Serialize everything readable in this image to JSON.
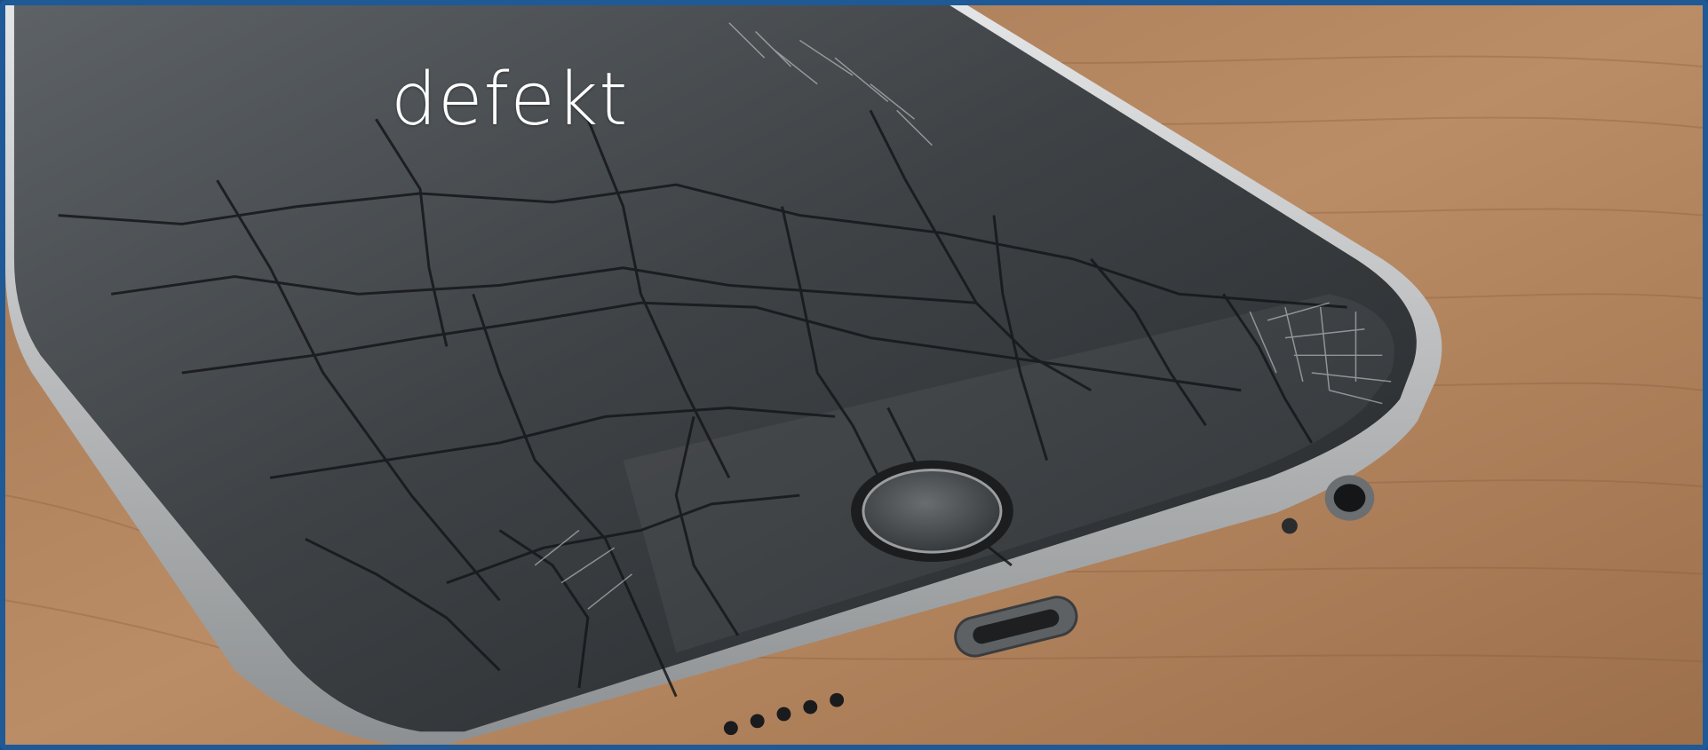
{
  "headline": "defekt",
  "image": {
    "subject": "smartphone-with-cracked-screen",
    "colors": {
      "frame": "#1f5a96",
      "wood": "#b98a62",
      "glass": "#3d4043",
      "bezel": "#c9cbcc",
      "text": "#ffffff"
    }
  }
}
